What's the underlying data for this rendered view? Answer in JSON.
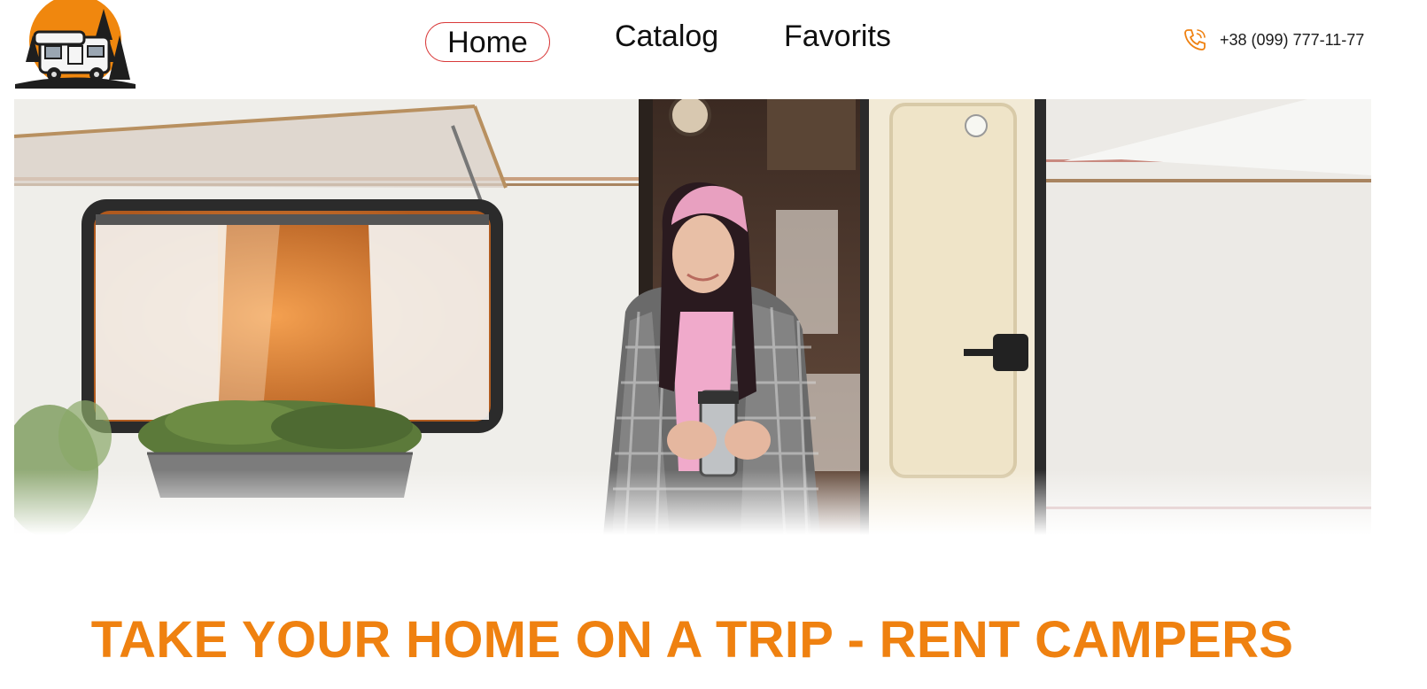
{
  "brand": {
    "logo_icon": "camper-van-sunset-logo",
    "accent_color": "#ef8110",
    "active_border_color": "#d93a3a"
  },
  "nav": {
    "items": [
      {
        "label": "Home",
        "active": true
      },
      {
        "label": "Catalog",
        "active": false
      },
      {
        "label": "Favorits",
        "active": false
      }
    ]
  },
  "contact": {
    "phone_icon": "phone-icon",
    "phone": "+38 (099) 777-11-77"
  },
  "hero": {
    "image": "woman-with-thermos-at-camper-door-photo",
    "headline": "TAKE YOUR HOME ON A TRIP - RENT CAMPERS"
  }
}
